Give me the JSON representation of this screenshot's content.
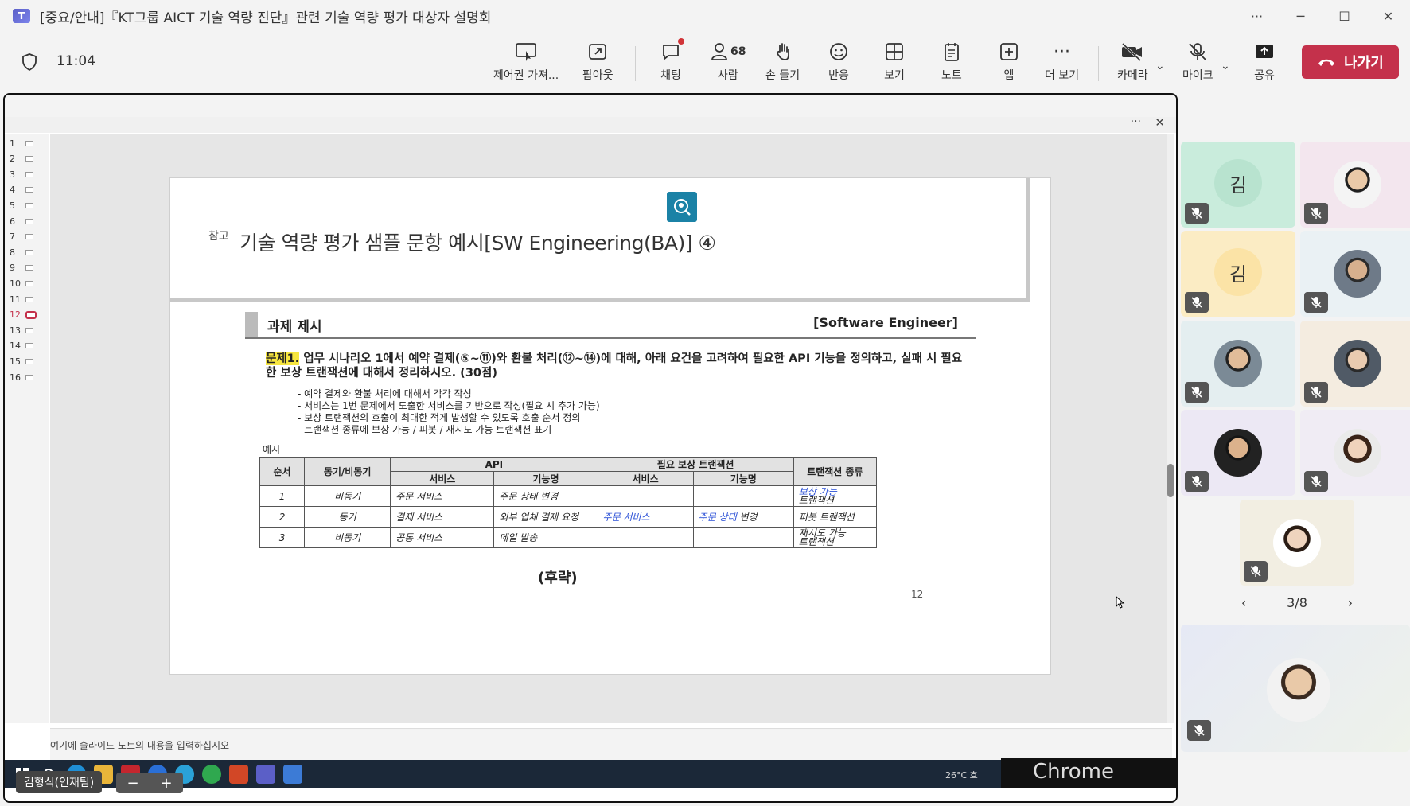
{
  "window": {
    "title": "[중요/안내]『KT그룹 AICT 기술 역량 진단』관련 기술 역량 평가 대상자 설명회",
    "controls": [
      "···",
      "─",
      "☐",
      "✕"
    ]
  },
  "toolbar": {
    "time": "11:04",
    "buttons": [
      {
        "label": "제어권 가져...",
        "icon": "take-control-icon"
      },
      {
        "label": "팝아웃",
        "icon": "popout-icon"
      },
      {
        "label": "채팅",
        "icon": "chat-icon"
      },
      {
        "label": "사람",
        "icon": "people-icon",
        "count": "68"
      },
      {
        "label": "손 들기",
        "icon": "raise-hand-icon"
      },
      {
        "label": "반응",
        "icon": "reaction-icon"
      },
      {
        "label": "보기",
        "icon": "view-icon"
      },
      {
        "label": "노트",
        "icon": "notes-icon"
      },
      {
        "label": "앱",
        "icon": "apps-icon"
      },
      {
        "label": "더 보기",
        "icon": "more-icon"
      },
      {
        "label": "카메라",
        "icon": "camera-off-icon"
      },
      {
        "label": "마이크",
        "icon": "mic-off-icon"
      },
      {
        "label": "공유",
        "icon": "share-icon"
      }
    ],
    "leave_label": "나가기"
  },
  "ppt": {
    "slide_numbers": [
      "1",
      "2",
      "3",
      "4",
      "5",
      "6",
      "7",
      "8",
      "9",
      "10",
      "11",
      "12",
      "13",
      "14",
      "15",
      "16"
    ],
    "active_slide": "12",
    "notes_placeholder": "여기에 슬라이드 노트의 내용을 입력하십시오"
  },
  "slide": {
    "ref": "참고",
    "title": "기술 역량 평가 샘플 문항 예시[SW Engineering(BA)] ④",
    "task_title": "과제 제시",
    "task_role": "[Software Engineer]",
    "problem_label": "문제1.",
    "problem_text": " 업무 시나리오 1에서 예약 결제(⑤~⑪)와 환불 처리(⑫~⑭)에 대해, 아래 요건을 고려하여 필요한 API 기능을 정의하고, 실패 시 필요한 보상 트랜잭션에 대해서 정리하시오. (30점)",
    "requirements": [
      "- 예약 결제와 환불 처리에 대해서 각각 작성",
      "- 서비스는 1번 문제에서 도출한 서비스를 기반으로 작성(필요 시 추가 가능)",
      "- 보상 트랜잭션의 호출이 최대한 적게 발생할 수 있도록 호출 순서 정의",
      "- 트랜잭션 종류에 보상 가능 / 피봇 / 재시도 가능 트랜잭션 표기"
    ],
    "example_label": "예시",
    "table": {
      "h_order": "순서",
      "h_sync": "동기/비동기",
      "h_api": "API",
      "h_comp": "필요 보상 트랜잭션",
      "h_type": "트랜잭션 종류",
      "h_service": "서비스",
      "h_function": "기능명",
      "rows": [
        {
          "order": "1",
          "sync": "비동기",
          "service": "주문 서비스",
          "function": "주문 상태 변경",
          "comp_service": "",
          "comp_function": "",
          "type_a": "보상 가능",
          "type_b": "트랜잭션"
        },
        {
          "order": "2",
          "sync": "동기",
          "service": "결제 서비스",
          "function": "외부 업체 결제 요청",
          "comp_service": "주문 서비스",
          "comp_function_a": "주문 상태",
          "comp_function_b": " 변경",
          "type_a": "피봇 트랜잭션",
          "type_b": ""
        },
        {
          "order": "3",
          "sync": "비동기",
          "service": "공통 서비스",
          "function": "메일 발송",
          "comp_service": "",
          "comp_function": "",
          "type_a": "재시도 가능",
          "type_b": "트랜잭션"
        }
      ]
    },
    "omitted": "(후략)",
    "page_number": "12"
  },
  "taskbar": {
    "weather": "26°C 흐",
    "chrome_label": "Chrome",
    "name_tag": "김형식(인재팀)",
    "zoom_minus": "−",
    "zoom_plus": "+"
  },
  "participants": {
    "tiles": [
      {
        "initial": "김",
        "bg": "#c9ecdc"
      },
      {
        "initial": "",
        "bg": "#f3e6ee"
      },
      {
        "initial": "김",
        "bg": "#fbecc4"
      },
      {
        "initial": "",
        "bg": "#eaf1f4"
      },
      {
        "initial": "",
        "bg": "#e4eef0"
      },
      {
        "initial": "",
        "bg": "#f4ece0"
      },
      {
        "initial": "",
        "bg": "#ece8f4"
      },
      {
        "initial": "",
        "bg": "#f0ecf4"
      },
      {
        "initial": "",
        "bg": "#f2eee2"
      }
    ],
    "pager": "3/8"
  },
  "colors": {
    "leave": "#c4314b",
    "accent": "#5b5fc7",
    "highlight": "#f7e640"
  }
}
